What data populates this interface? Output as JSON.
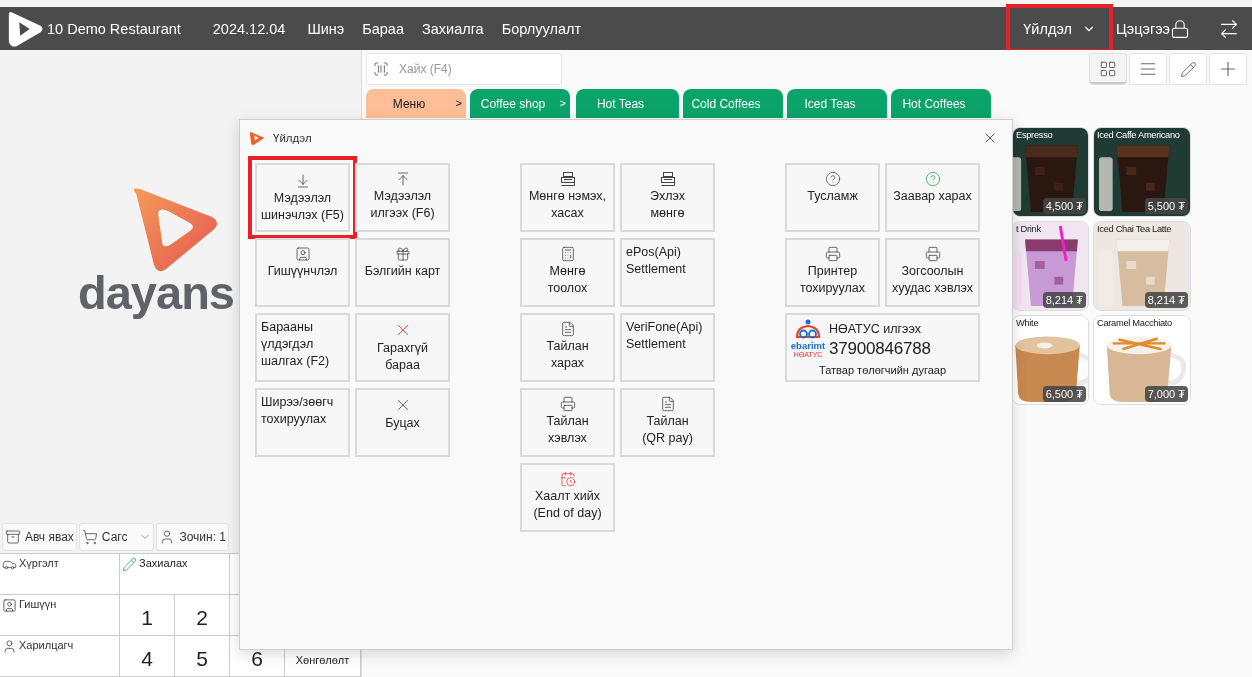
{
  "topbar": {
    "store": "10 Demo Restaurant",
    "date": "2024.12.04",
    "menu": [
      "Шинэ",
      "Бараа",
      "Захиалга",
      "Борлуулалт"
    ],
    "actions_menu": {
      "label": "Үйлдэл",
      "highlighted": true
    },
    "user": "Цэцэгээ"
  },
  "brand": {
    "logo_text": "dayans"
  },
  "order_toolbar": [
    {
      "kind": "takeaway",
      "label": "Авч явах"
    },
    {
      "kind": "cart",
      "label": "Сагс"
    },
    {
      "kind": "guest",
      "label": "Зочин: 1"
    }
  ],
  "keypad": [
    {
      "side": {
        "kind": "delivery",
        "label": "Хүргэлт"
      },
      "keys": [
        {
          "kind": "order",
          "label": "Захиалах"
        }
      ]
    },
    {
      "side": {
        "kind": "member",
        "label": "Гишүүн"
      },
      "keys": [
        {
          "kind": "digit",
          "label": "1"
        },
        {
          "kind": "digit",
          "label": "2"
        }
      ]
    },
    {
      "side": {
        "kind": "customer",
        "label": "Харилцагч"
      },
      "keys": [
        {
          "kind": "digit",
          "label": "4"
        },
        {
          "kind": "digit",
          "label": "5"
        },
        {
          "kind": "digit",
          "label": "6"
        },
        {
          "kind": "text",
          "label": "Хөнгөлөлт"
        }
      ]
    }
  ],
  "search": {
    "placeholder": "Хайх (F4)"
  },
  "view_modes": [
    {
      "kind": "grid",
      "selected": true
    },
    {
      "kind": "list",
      "selected": false
    }
  ],
  "categories": [
    {
      "label": "Меню",
      "suffix": ">",
      "selected": true
    },
    {
      "label": "Coffee shop",
      "suffix": ">",
      "selected": false
    },
    {
      "label": "Hot Teas",
      "selected": false
    },
    {
      "label": "Cold Coffees",
      "selected": false
    },
    {
      "label": "Iced Teas",
      "selected": false
    },
    {
      "label": "Hot Coffees",
      "selected": false
    }
  ],
  "products": [
    {
      "name": "Espresso",
      "price": "4,500 ₮"
    },
    {
      "name": "Iced Caffe Americano",
      "price": "5,500 ₮"
    },
    {
      "name": "t Drink",
      "price": "8,214 ₮"
    },
    {
      "name": "Iced Chai Tea Latte",
      "price": "8,214 ₮"
    },
    {
      "name": "White",
      "price": "6,500 ₮"
    },
    {
      "name": "Caramel Macchiato",
      "price": "7,000 ₮"
    }
  ],
  "dialog": {
    "title": "Үйлдэл",
    "groups": [
      {
        "tiles": [
          {
            "kind": "download",
            "label": "Мэдээлэл\nшинэчлэх (F5)",
            "highlighted": true
          },
          {
            "kind": "upload",
            "label": "Мэдээлэл\nилгээх (F6)",
            "highlighted": false
          },
          {
            "kind": "member",
            "label": "Гишүүнчлэл",
            "highlighted": false
          },
          {
            "kind": "gift",
            "label": "Бэлгийн карт",
            "highlighted": false
          },
          {
            "kind": "plain",
            "label": "Барааны\nүлдэгдэл\nшалгах (F2)",
            "highlighted": false
          },
          {
            "kind": "cancel",
            "label": "Гарахгүй\nбараа",
            "highlighted": false
          },
          {
            "kind": "plain",
            "label": "Ширээ/зөөгч\nтохируулах",
            "highlighted": false
          },
          {
            "kind": "close",
            "label": "Буцах",
            "highlighted": false
          }
        ]
      },
      {
        "tiles": [
          {
            "kind": "cash-drawer",
            "label": "Мөнгө нэмэх,\nхасах",
            "highlighted": false
          },
          {
            "kind": "cash-drawer",
            "label": "Эхлэх\nмөнгө",
            "highlighted": false
          },
          {
            "kind": "calculator",
            "label": "Мөнгө\nтоолох",
            "highlighted": false
          },
          {
            "kind": "plain",
            "label": "ePos(Api)\nSettlement",
            "highlighted": false
          },
          {
            "kind": "report",
            "label": "Тайлан\nхарах",
            "highlighted": false
          },
          {
            "kind": "plain",
            "label": "VeriFone(Api)\nSettlement",
            "highlighted": false
          },
          {
            "kind": "printer",
            "label": "Тайлан\nхэвлэх",
            "highlighted": false
          },
          {
            "kind": "report",
            "label": "Тайлан\n(QR pay)",
            "highlighted": false
          },
          {
            "kind": "calendar",
            "label": "Хаалт хийх\n(End of day)",
            "highlighted": false
          }
        ]
      },
      {
        "tiles": [
          {
            "kind": "help",
            "label": "Тусламж",
            "highlighted": false
          },
          {
            "kind": "help-accent",
            "label": "Заавар харах",
            "highlighted": false
          },
          {
            "kind": "printer",
            "label": "Принтер\nтохируулах",
            "highlighted": false
          },
          {
            "kind": "printer",
            "label": "Зогсоолын\nхуудас хэвлэх",
            "highlighted": false
          },
          {
            "kind": "tax",
            "label": "НӨАТУС илгээх",
            "number": "37900846788",
            "caption": "Татвар төлөгчийн дугаар",
            "logo_text": "ebarimt",
            "logo_subtitle": "НӨАТУС",
            "highlighted": false
          }
        ]
      }
    ]
  }
}
